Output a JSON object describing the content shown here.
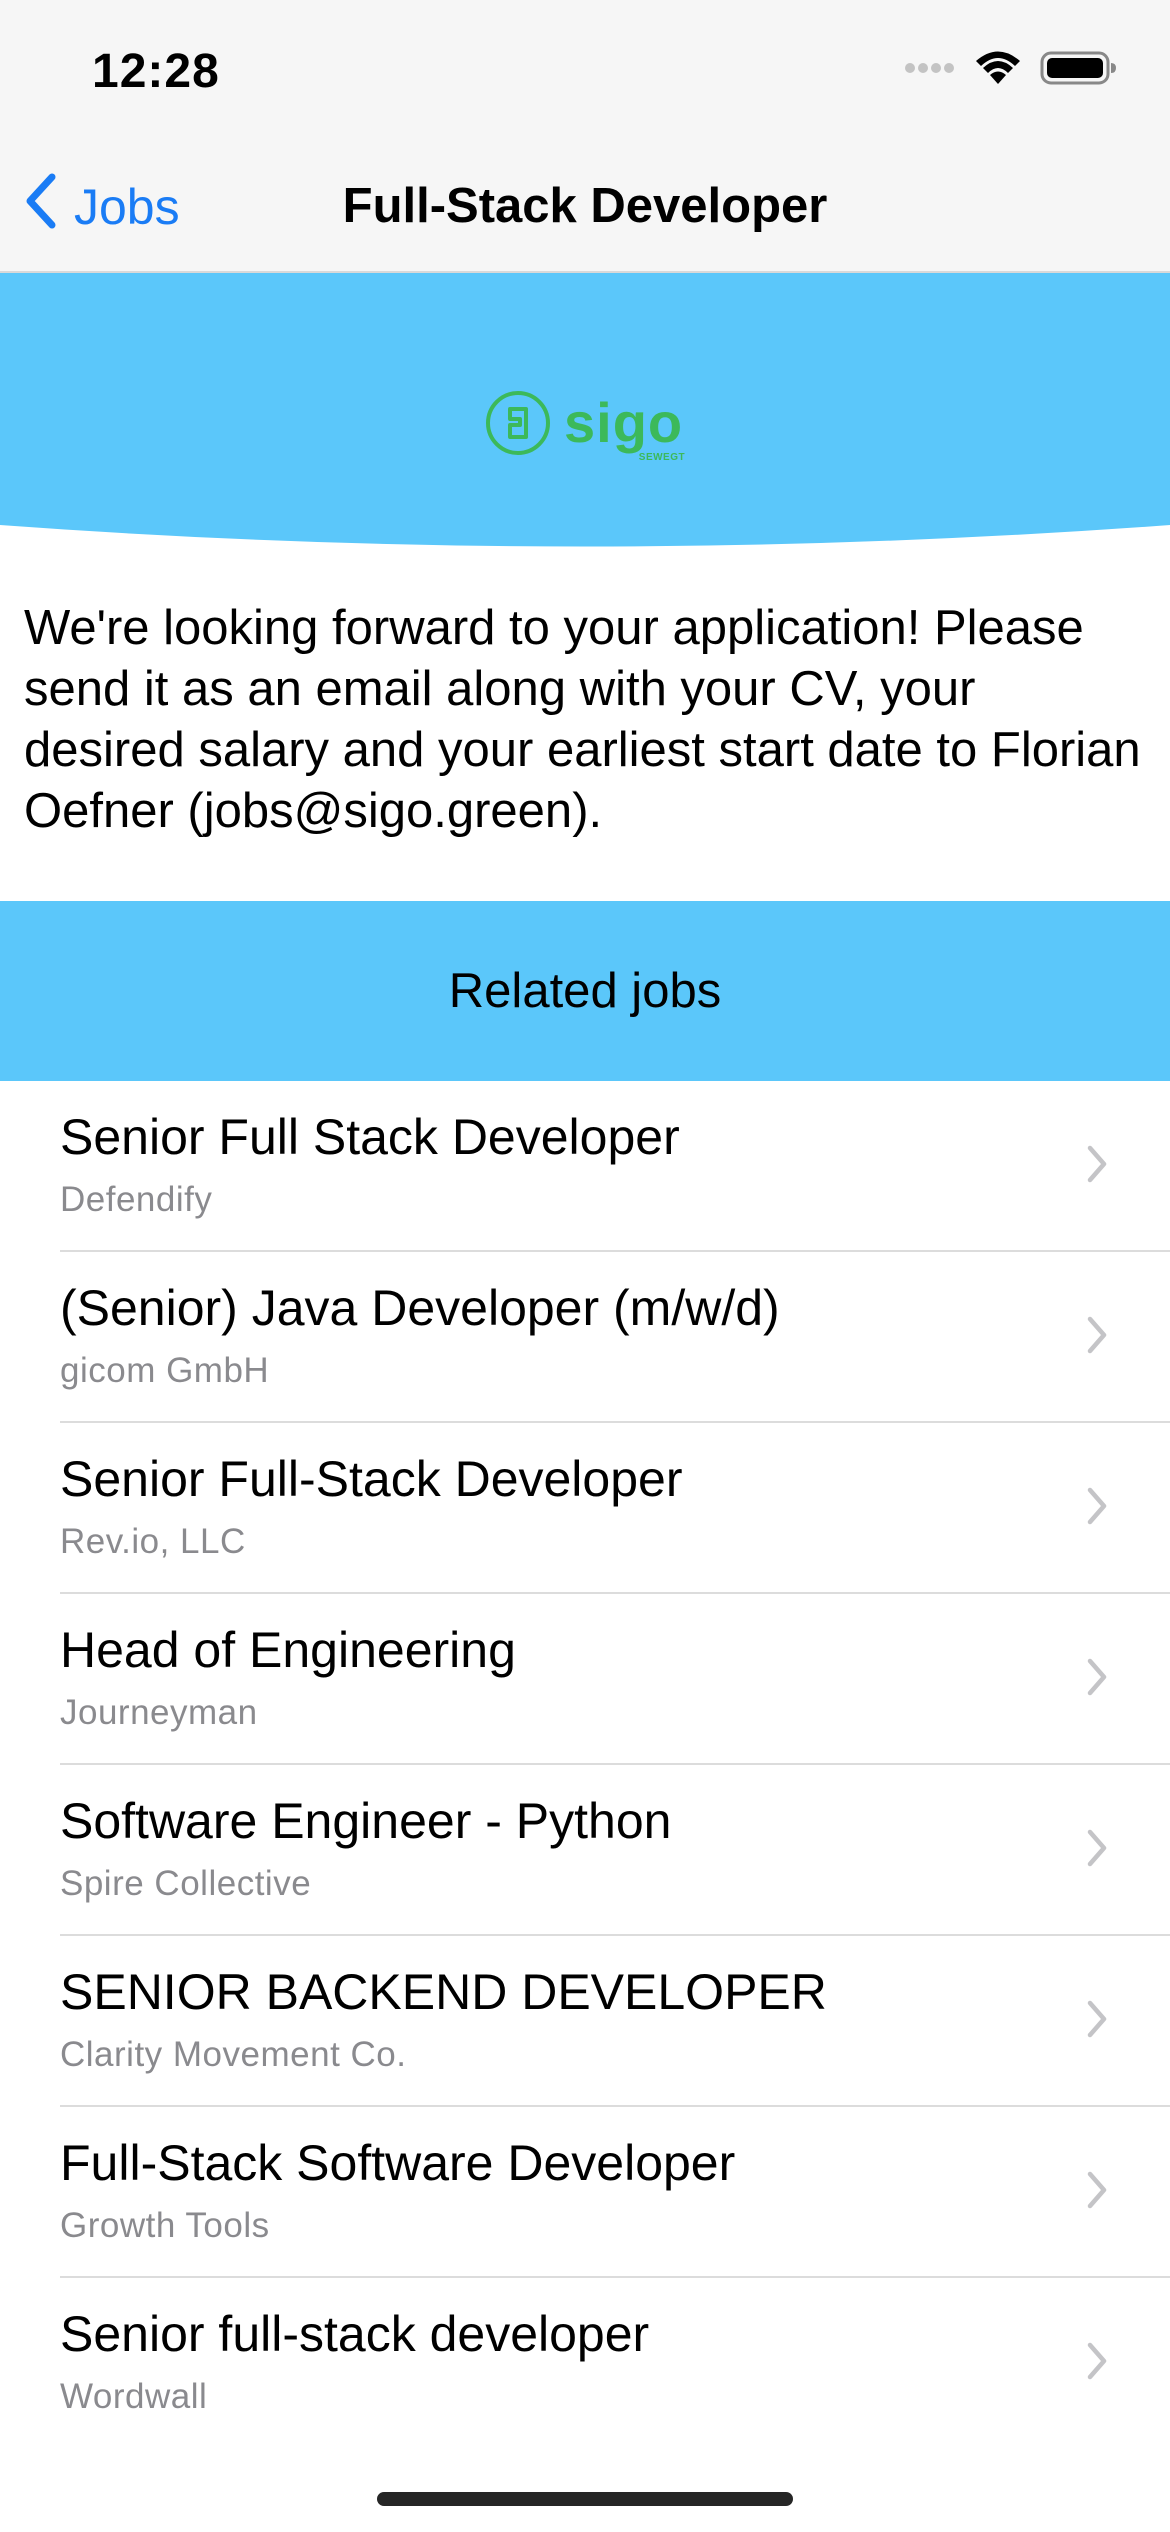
{
  "status_bar": {
    "time": "12:28",
    "icons": [
      "signal-dots-icon",
      "wifi-icon",
      "battery-icon"
    ]
  },
  "nav": {
    "back_label": "Jobs",
    "title": "Full-Stack Developer"
  },
  "header": {
    "logo_text": "sigo",
    "logo_subtext": "SEWEGT",
    "banner_color": "#5bc7fa",
    "logo_color": "#3cb95a"
  },
  "message": "We're looking forward to your application! Please send it as an email along with your CV, your desired salary and your earliest start date to Florian Oefner (jobs@sigo.green).",
  "related": {
    "title": "Related jobs",
    "jobs": [
      {
        "title": "Senior Full Stack Developer",
        "company": "Defendify"
      },
      {
        "title": "(Senior) Java Developer (m/w/d)",
        "company": "gicom GmbH"
      },
      {
        "title": "Senior Full-Stack Developer",
        "company": "Rev.io, LLC"
      },
      {
        "title": "Head of Engineering",
        "company": "Journeyman"
      },
      {
        "title": "Software Engineer - Python",
        "company": "Spire Collective"
      },
      {
        "title": "SENIOR BACKEND DEVELOPER",
        "company": "Clarity Movement Co."
      },
      {
        "title": "Full-Stack Software Developer",
        "company": "Growth Tools"
      },
      {
        "title": "Senior full-stack developer",
        "company": "Wordwall"
      }
    ]
  },
  "colors": {
    "accent": "#1a7cf5",
    "secondary_text": "#8a8a8e"
  }
}
